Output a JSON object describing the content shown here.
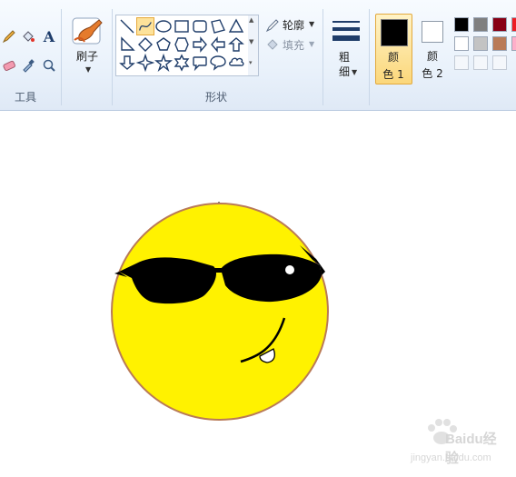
{
  "ribbon": {
    "tools_group_label": "工具",
    "brush_label": "刷子",
    "shapes_group_label": "形状",
    "outline_label": "轮廓",
    "fill_label": "填充",
    "size_label": "粗细",
    "color1_label": "颜色 1",
    "color2_label": "颜色 2",
    "color1_value": "#000000",
    "color2_value": "#ffffff",
    "palette": [
      "#000000",
      "#7f7f7f",
      "#880015",
      "#ed1c24",
      "#ffffff",
      "#c3c3c3",
      "#b97a57",
      "#ffaec9",
      "",
      "",
      ""
    ]
  },
  "canvas": {
    "face_color": "#fff200",
    "face_outline": "#b97a57",
    "glasses_color": "#000000"
  },
  "watermark": {
    "text": "Baidu经验",
    "url": "jingyan.baidu.com"
  }
}
